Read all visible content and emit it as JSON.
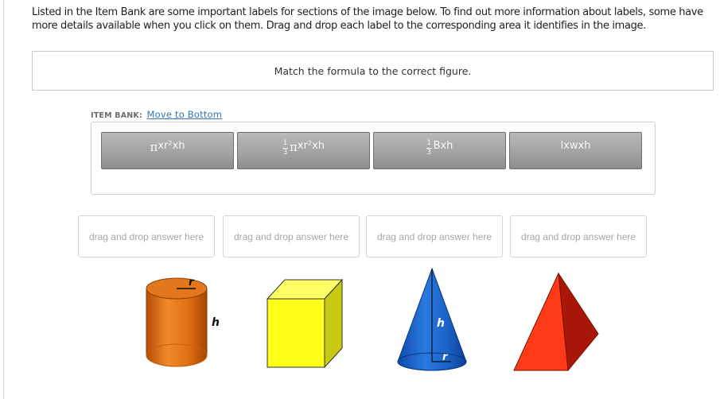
{
  "instructions": "Listed in the Item Bank are some important labels for sections of the image below. To find out more information about labels, some have more details available when you click on them. Drag and drop each label to the corresponding area it identifies in the image.",
  "prompt": "Match the formula to the correct figure.",
  "item_bank": {
    "label": "ITEM BANK:",
    "move_link": "Move to Bottom",
    "tiles": [
      {
        "pi": "π",
        "text": "xr²xh"
      },
      {
        "frac_num": "1",
        "frac_den": "3",
        "pi": "π",
        "text": "xr²xh"
      },
      {
        "frac_num": "1",
        "frac_den": "3",
        "text": "Bxh"
      },
      {
        "text": "lxwxh"
      }
    ]
  },
  "dropzones": [
    "drag and drop answer here",
    "drag and drop answer here",
    "drag and drop answer here",
    "drag and drop answer here"
  ],
  "figures": {
    "cylinder": {
      "r_label": "r",
      "h_label": "h",
      "color": "#e8741a"
    },
    "cube": {
      "color": "#ffff22"
    },
    "cone": {
      "h_label": "h",
      "r_label": "r",
      "color": "#1a63c9"
    },
    "pyramid": {
      "color": "#ee2a10"
    }
  }
}
